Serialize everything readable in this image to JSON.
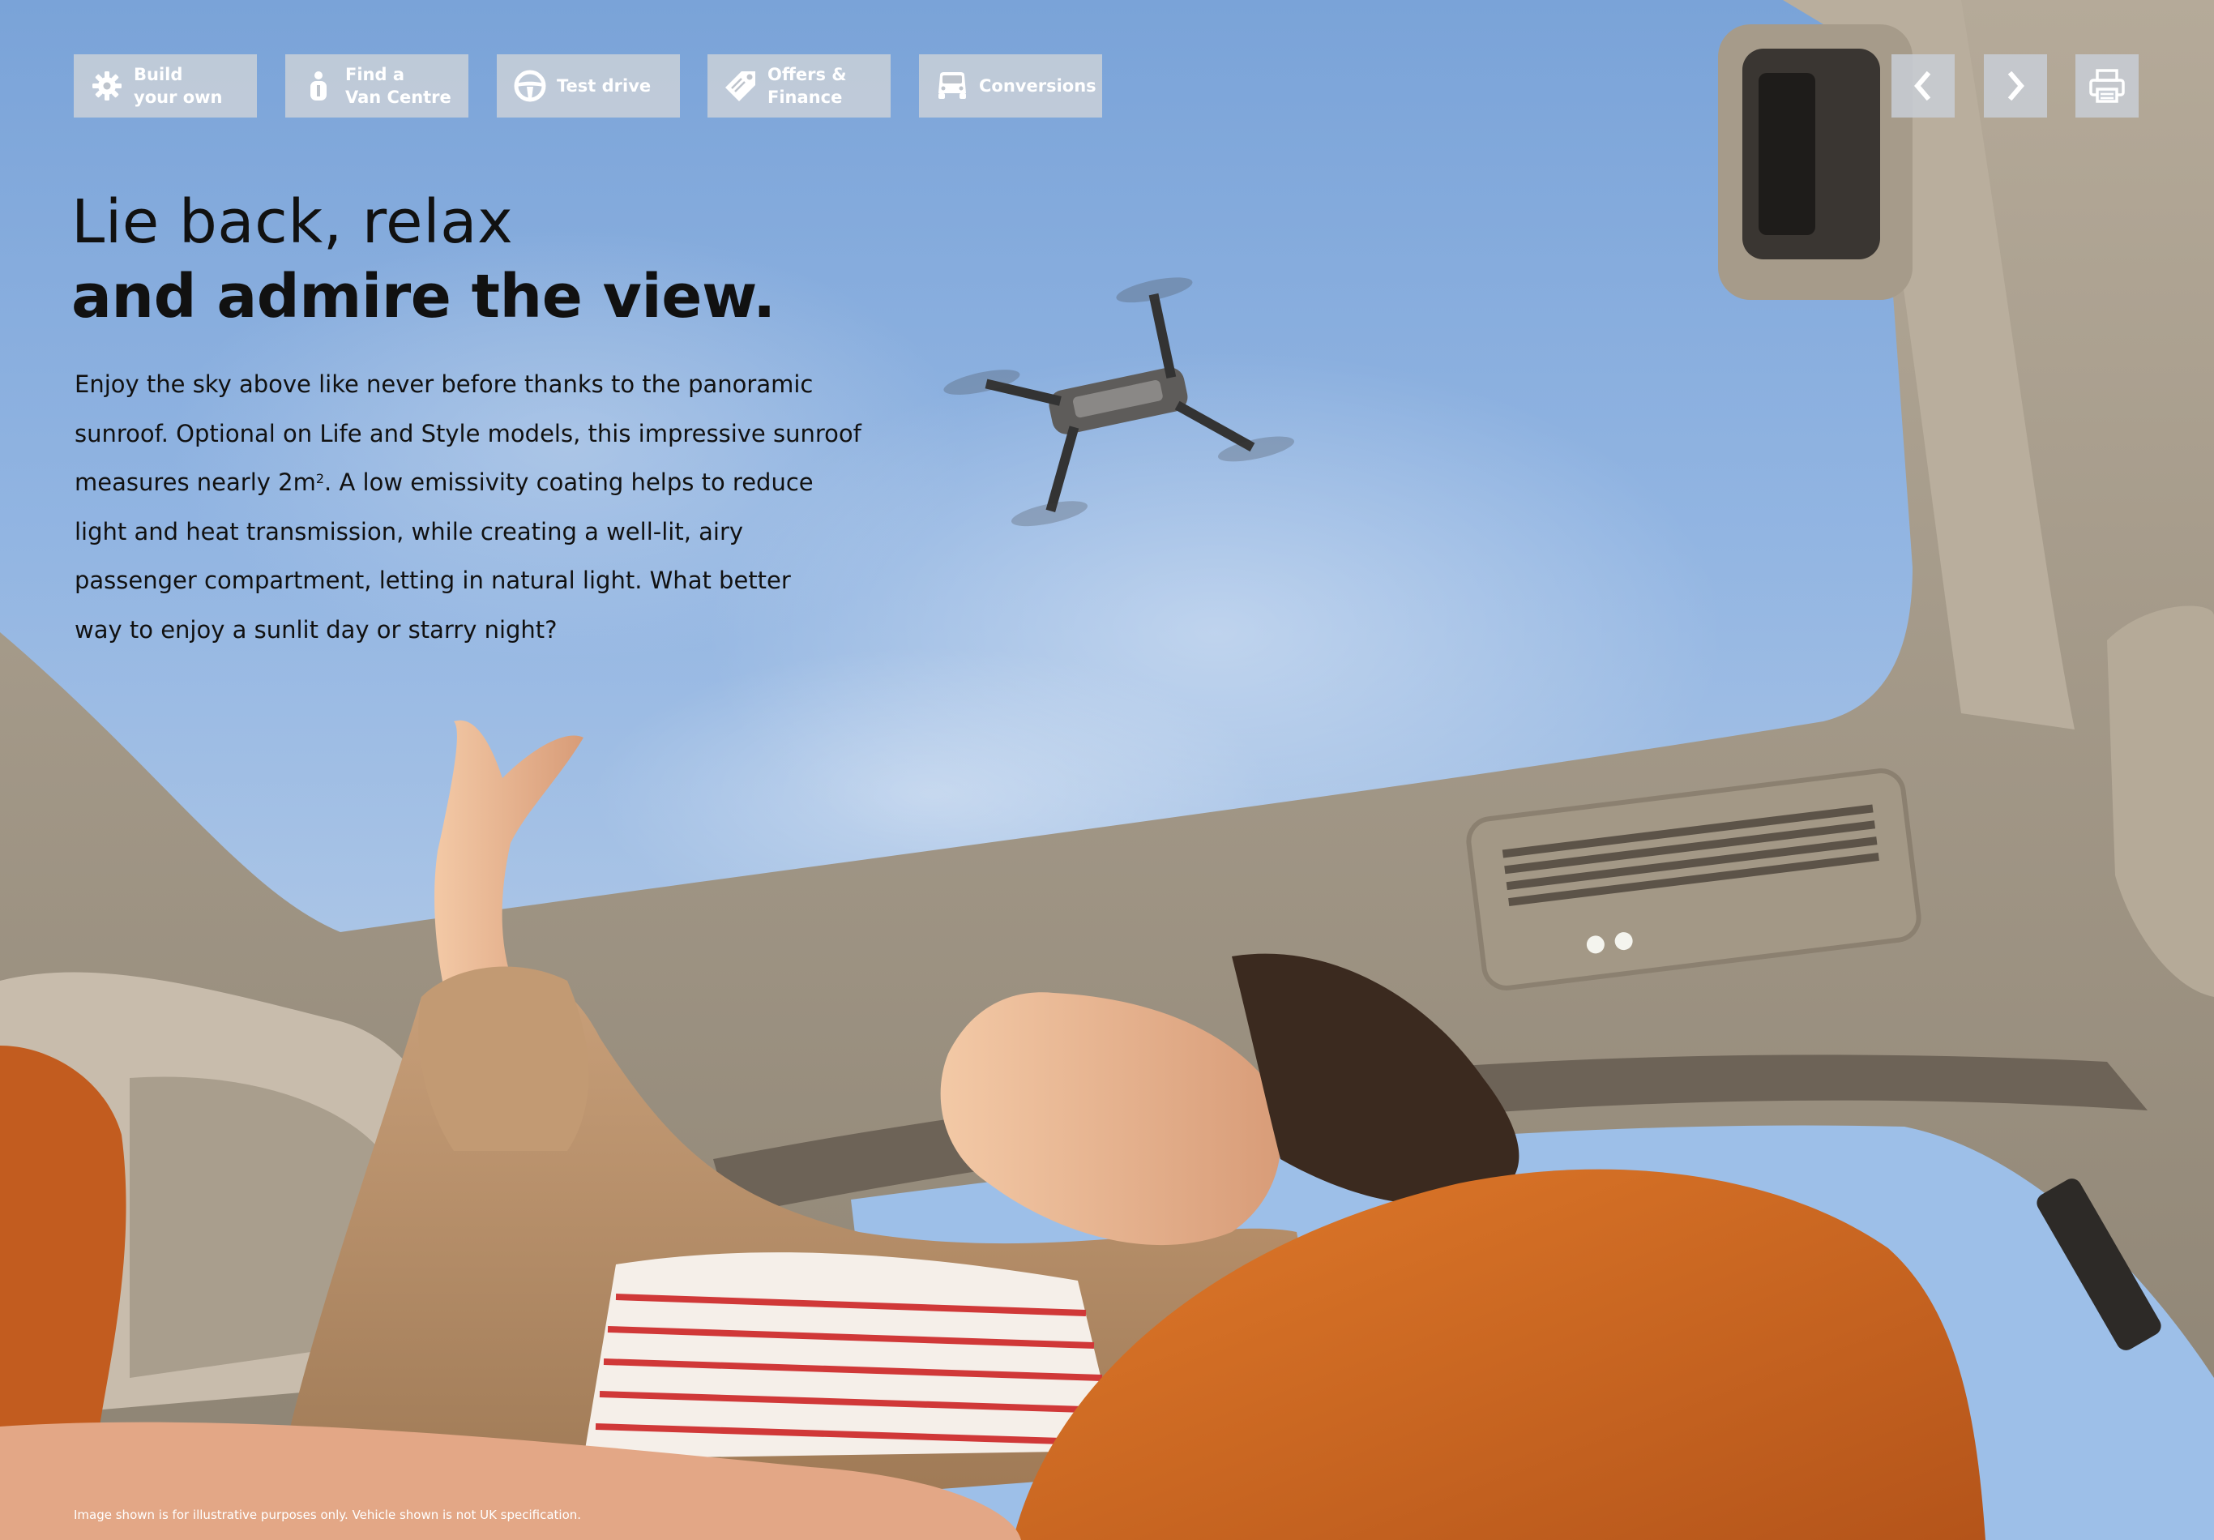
{
  "toolbar": {
    "items": [
      {
        "label": "Build\nyour own",
        "icon": "gear-icon"
      },
      {
        "label": "Find a\nVan Centre",
        "icon": "info-person-icon"
      },
      {
        "label": "Test drive",
        "icon": "steering-wheel-icon"
      },
      {
        "label": "Offers &\nFinance",
        "icon": "tag-icon"
      },
      {
        "label": "Conversions",
        "icon": "van-icon"
      }
    ]
  },
  "controls": {
    "prev_icon": "chevron-left-icon",
    "next_icon": "chevron-right-icon",
    "print_icon": "printer-icon"
  },
  "headline": {
    "line1": "Lie back, relax",
    "line2": "and admire the view."
  },
  "body": {
    "line1": "Enjoy the sky above like never before thanks to the panoramic",
    "line2": "sunroof. Optional on Life and Style models, this impressive sunroof",
    "line3_a": "measures nearly 2m",
    "line3_sup": "2",
    "line3_b": ". A low emissivity coating helps to reduce",
    "line4": "light and heat transmission, while creating a well-lit, airy",
    "line5": "passenger compartment, letting in natural light. What better",
    "line6": "way to enjoy a sunlit day or starry night?"
  },
  "disclaimer": "Image shown is for illustrative purposes only. Vehicle shown is not UK specification.",
  "colors": {
    "sky": "#92b5e2",
    "headliner": "#a99e8e",
    "button_bg": "#cdd2d8",
    "text": "#111111",
    "orange_jumper": "#d2691e"
  }
}
